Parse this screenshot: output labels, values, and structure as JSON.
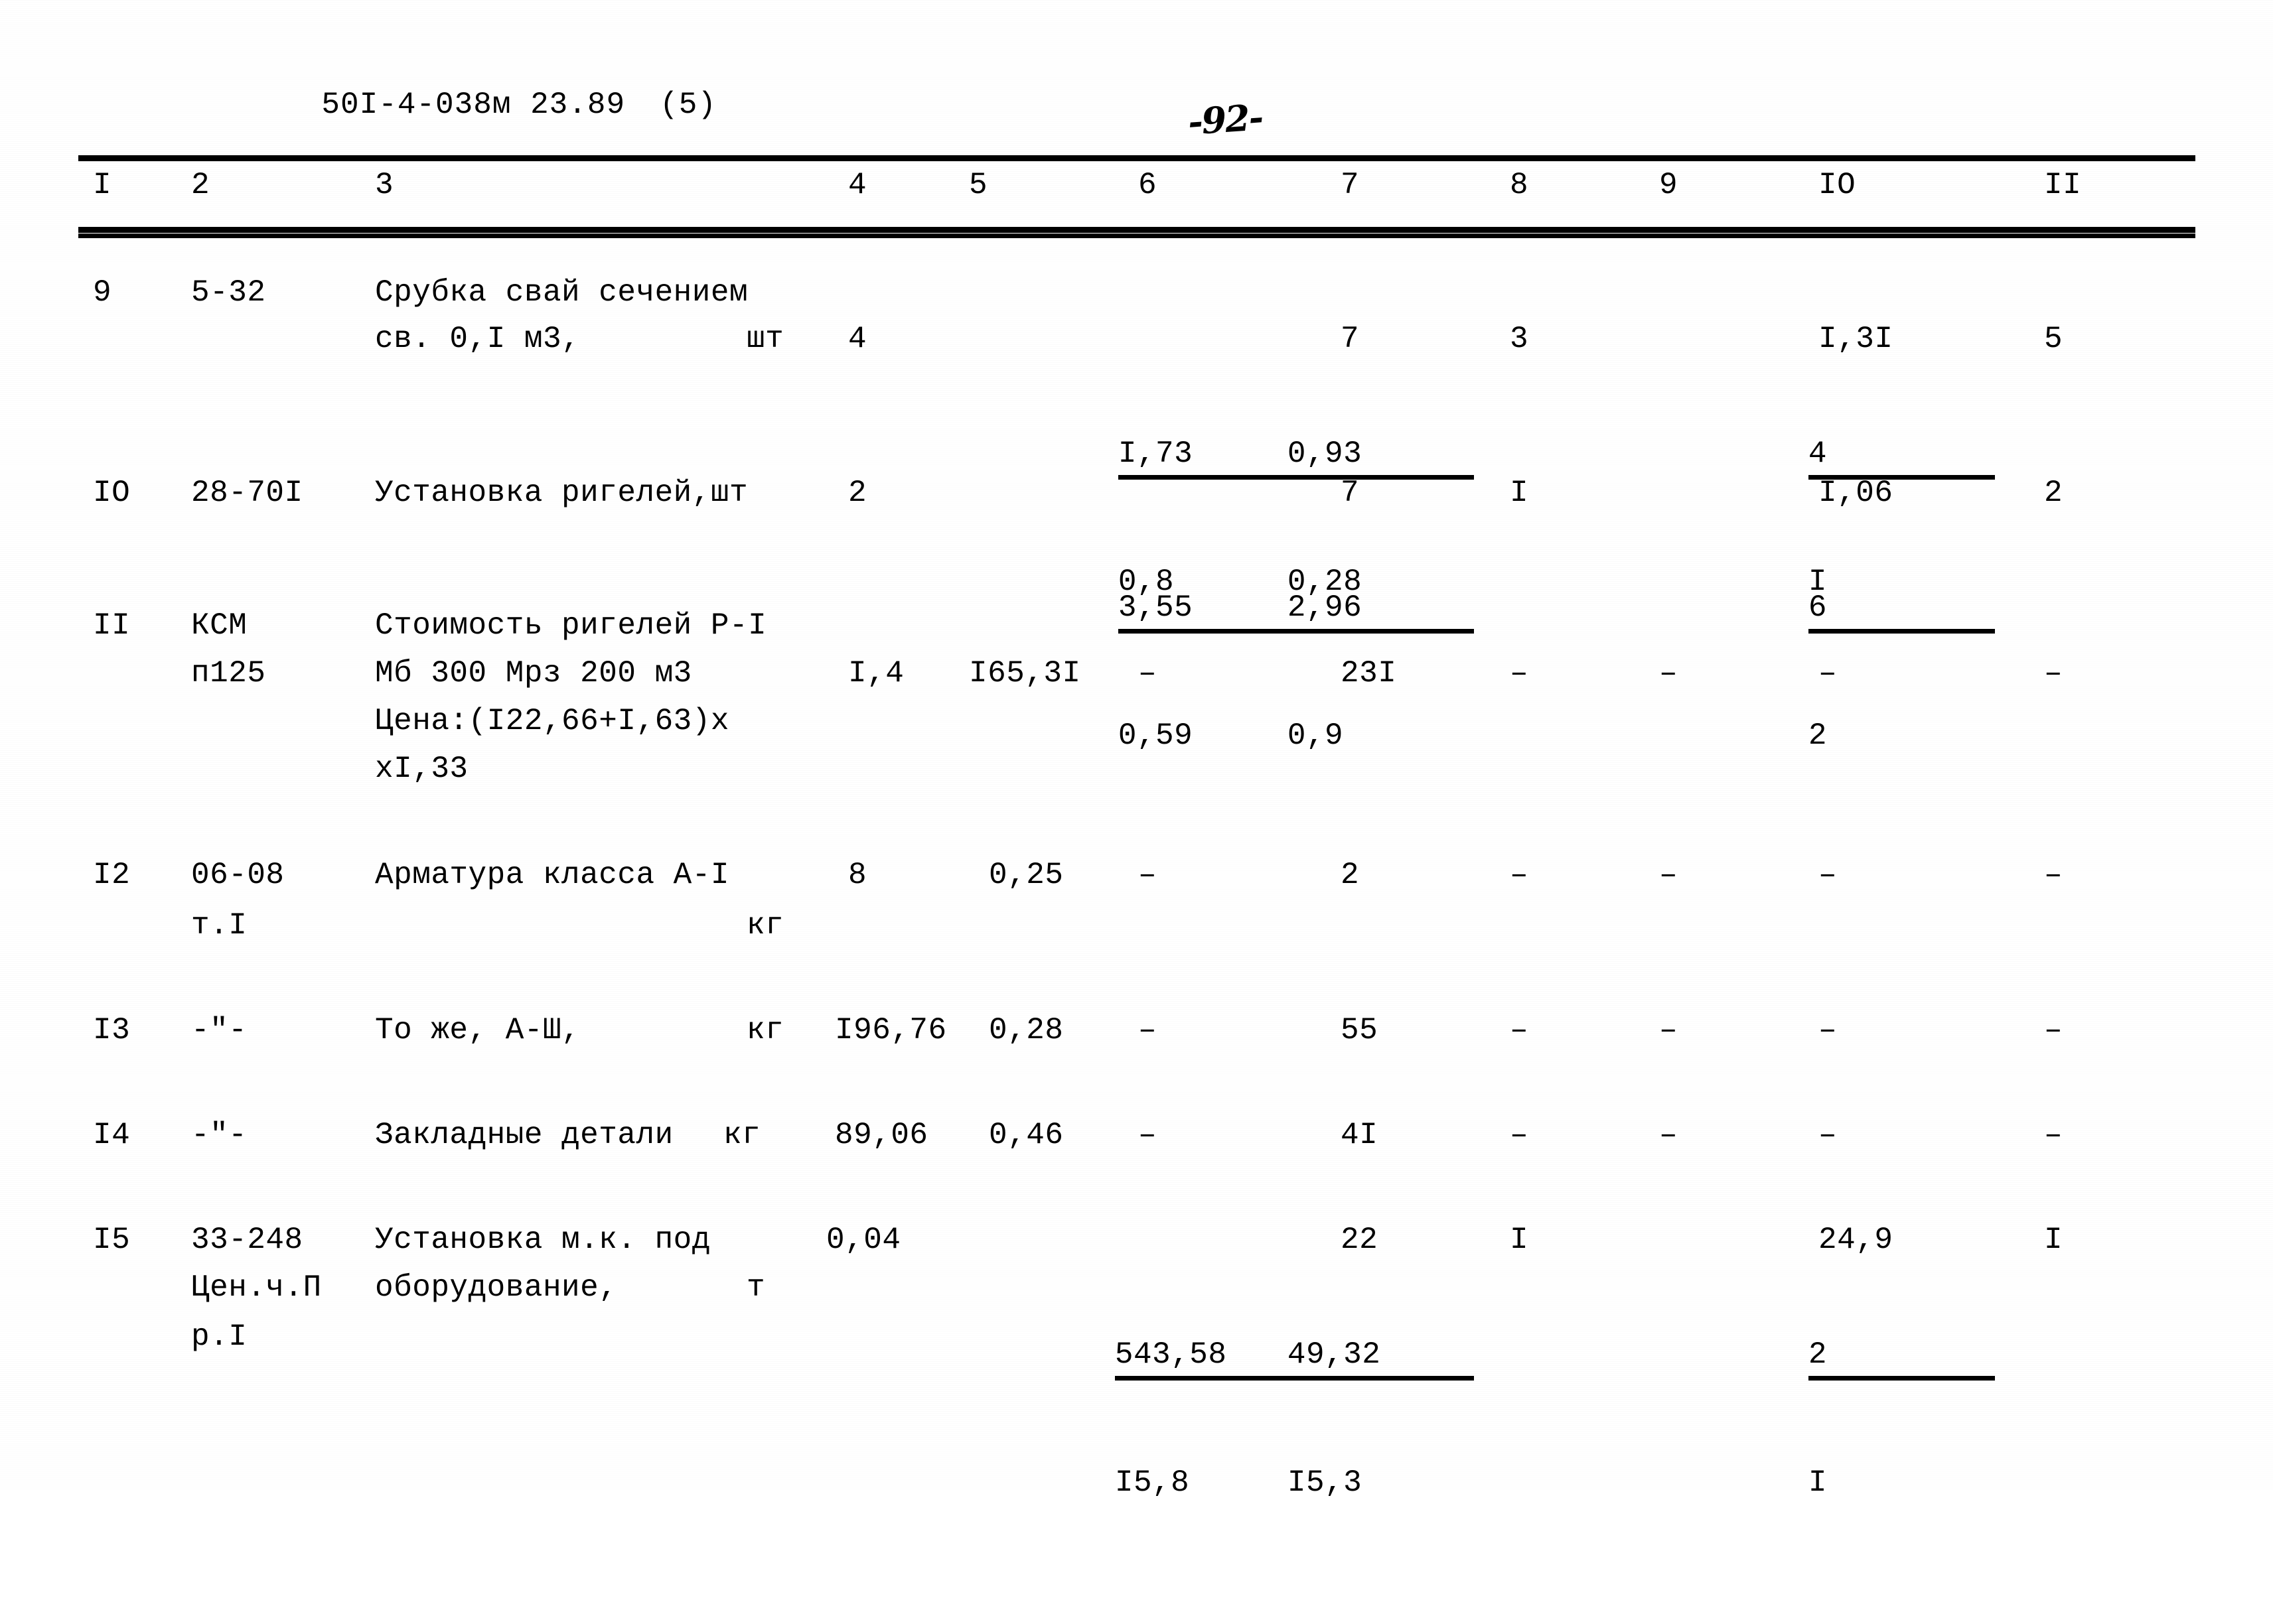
{
  "document": {
    "code": "50I-4-038м 23.89",
    "sheet": "(5)",
    "page_number": "-92-"
  },
  "table": {
    "column_headers": [
      "I",
      "2",
      "3",
      "4",
      "5",
      "6",
      "7",
      "8",
      "9",
      "IO",
      "II"
    ],
    "rows": [
      {
        "no": "9",
        "code": "5-32",
        "desc_line1": "Срубка свай сечением",
        "desc_line2": "св. 0,I м3,",
        "unit": "шт",
        "c4": "4",
        "c5_num": "I,73",
        "c5_den": "0,8",
        "c6_num": "0,93",
        "c6_den": "0,28",
        "c7": "7",
        "c8": "3",
        "c9_num": "4",
        "c9_den": "I",
        "c10": "I,3I",
        "c11": "5"
      },
      {
        "no": "IO",
        "code": "28-70I",
        "desc_line1": "Установка ригелей,шт",
        "c4": "2",
        "c5_num": "3,55",
        "c5_den": "0,59",
        "c6_num": "2,96",
        "c6_den": "0,9",
        "c7": "7",
        "c8": "I",
        "c9_num": "6",
        "c9_den": "2",
        "c10": "I,06",
        "c11": "2"
      },
      {
        "no": "II",
        "code_line1": "КСМ",
        "code_line2": "п125",
        "desc_line1": "Стоимость ригелей Р-I",
        "desc_line2": "Мб 300 Мрз 200 м3",
        "desc_line3": "Цена:(I22,66+I,63)х",
        "desc_line4": "хI,33",
        "c4": "I,4",
        "c5": "I65,3I",
        "c6": "–",
        "c7": "23I",
        "c8": "–",
        "c9": "–",
        "c10": "–",
        "c11": "–"
      },
      {
        "no": "I2",
        "code_line1": "06-08",
        "code_line2": "т.I",
        "desc_line1": "Арматура класса А-I",
        "unit": "кг",
        "c4": "8",
        "c5": "0,25",
        "c6": "–",
        "c7": "2",
        "c8": "–",
        "c9": "–",
        "c10": "–",
        "c11": "–"
      },
      {
        "no": "I3",
        "code": "-\"-",
        "desc_line1": "То же, А-Ш,",
        "unit": "кг",
        "c4": "I96,76",
        "c5": "0,28",
        "c6": "–",
        "c7": "55",
        "c8": "–",
        "c9": "–",
        "c10": "–",
        "c11": "–"
      },
      {
        "no": "I4",
        "code": "-\"-",
        "desc_line1": "Закладные детали",
        "unit": "кг",
        "c4": "89,06",
        "c5": "0,46",
        "c6": "–",
        "c7": "4I",
        "c8": "–",
        "c9": "–",
        "c10": "–",
        "c11": "–"
      },
      {
        "no": "I5",
        "code_line1": "33-248",
        "code_line2": "Цен.ч.П",
        "code_line3": "р.I",
        "desc_line1": "Установка м.к. под",
        "desc_line2": "оборудование,",
        "unit": "т",
        "c4": "0,04",
        "c5_num": "543,58",
        "c5_den": "I5,8",
        "c6_num": "49,32",
        "c6_den": "I5,3",
        "c7": "22",
        "c8": "I",
        "c9_num": "2",
        "c9_den": "I",
        "c10": "24,9",
        "c11": "I"
      }
    ]
  }
}
